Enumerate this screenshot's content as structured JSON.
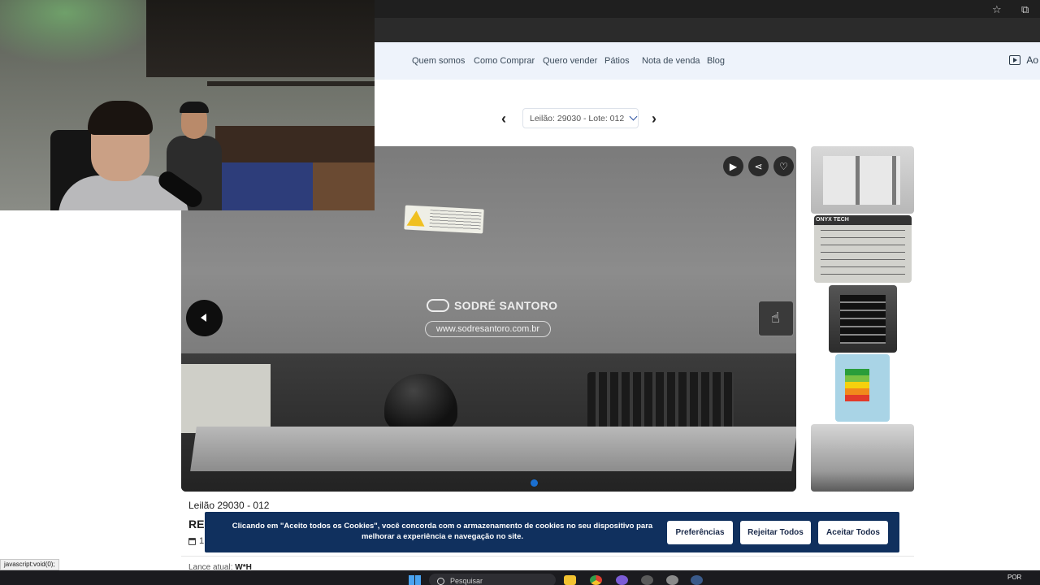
{
  "browser": {
    "star_icon": "star-icon",
    "extension_icon": "puzzle-icon"
  },
  "nav": {
    "items": [
      "Quem somos",
      "Como Comprar",
      "Quero vender",
      "Pátios",
      "Nota de venda",
      "Blog"
    ],
    "right_label": "Ao"
  },
  "lot_selector": {
    "value": "Leilão: 29030 - Lote: 012"
  },
  "photo": {
    "watermark_brand": "SODRÉ SANTORO",
    "watermark_url": "www.sodresantoro.com.br",
    "thumb_2_header": "ONYX TECH"
  },
  "lot": {
    "title": "Leilão 29030 - 012",
    "name": "RE",
    "date": "1",
    "bid_label": "Lance atual:",
    "bid_value": "W*H"
  },
  "cookie": {
    "message": "Clicando em \"Aceito todos os Cookies\", você concorda com o armazenamento de cookies no seu dispositivo para melhorar a experiência e navegação no site.",
    "preferences": "Preferências",
    "reject": "Rejeitar Todos",
    "accept": "Aceitar Todos"
  },
  "status_bar": {
    "text": "javascript:void(0);"
  },
  "taskbar": {
    "search_placeholder": "Pesquisar",
    "language": "POR"
  }
}
